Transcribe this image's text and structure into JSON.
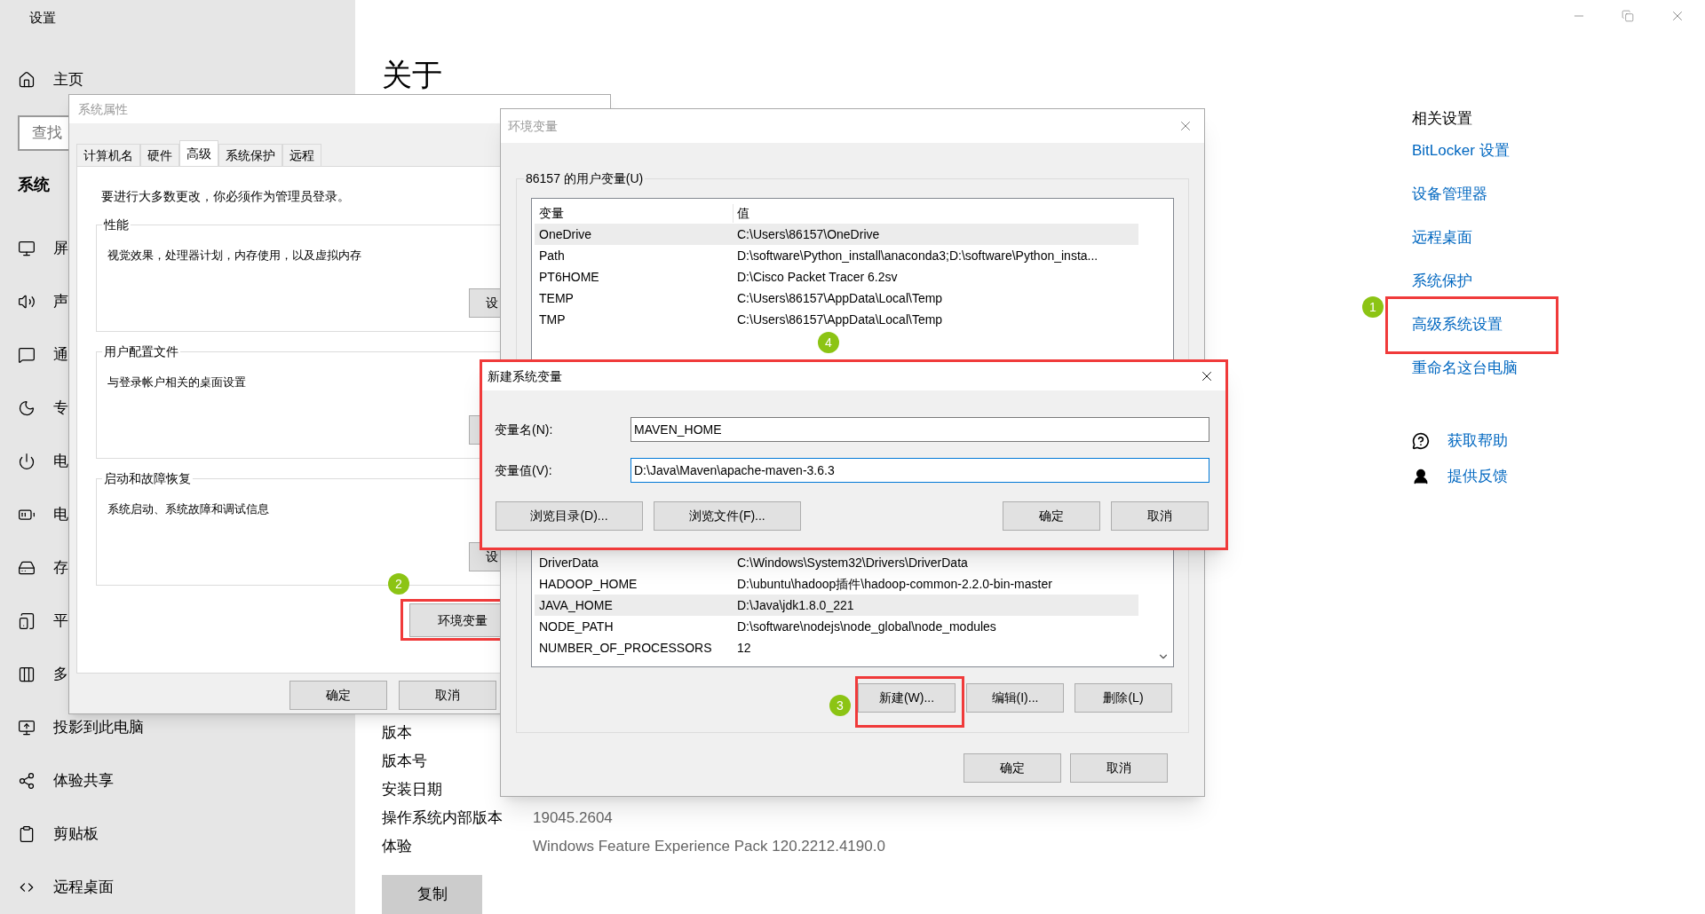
{
  "settings": {
    "title": "设置",
    "home": "主页",
    "search": {
      "placeholder": "查找"
    },
    "section": "系统",
    "items": [
      {
        "label": "屏"
      },
      {
        "label": "声"
      },
      {
        "label": "通"
      },
      {
        "label": "专"
      },
      {
        "label": "电"
      },
      {
        "label": "电"
      },
      {
        "label": "存"
      },
      {
        "label": "平"
      },
      {
        "label": "多"
      },
      {
        "label": "投影到此电脑"
      },
      {
        "label": "体验共享"
      },
      {
        "label": "剪贴板"
      },
      {
        "label": "远程桌面"
      }
    ]
  },
  "about": {
    "heading": "关于",
    "specs": [
      {
        "label": "版本"
      },
      {
        "label": "版本号"
      },
      {
        "label": "安装日期"
      },
      {
        "label": "操作系统内部版本",
        "value": "19045.2604"
      },
      {
        "label": "体验",
        "value": "Windows Feature Experience Pack 120.2212.4190.0"
      }
    ],
    "copy_button": "复制"
  },
  "related": {
    "heading": "相关设置",
    "links": [
      {
        "label": "BitLocker 设置"
      },
      {
        "label": "设备管理器"
      },
      {
        "label": "远程桌面"
      },
      {
        "label": "系统保护"
      },
      {
        "label": "高级系统设置",
        "marker": "1"
      },
      {
        "label": "重命名这台电脑"
      }
    ],
    "help_links": [
      {
        "label": "获取帮助",
        "kind": "help"
      },
      {
        "label": "提供反馈",
        "kind": "feedback"
      }
    ]
  },
  "system_properties": {
    "title": "系统属性",
    "tabs": [
      {
        "label": "计算机名",
        "selected": false
      },
      {
        "label": "硬件",
        "selected": false
      },
      {
        "label": "高级",
        "selected": true
      },
      {
        "label": "系统保护",
        "selected": false
      },
      {
        "label": "远程",
        "selected": false
      }
    ],
    "notice": "要进行大多数更改，你必须作为管理员登录。",
    "groups": [
      {
        "title": "性能",
        "description": "视觉效果，处理器计划，内存使用，以及虚拟内存",
        "button": "设"
      },
      {
        "title": "用户配置文件",
        "description": "与登录帐户相关的桌面设置"
      },
      {
        "title": "启动和故障恢复",
        "description": "系统启动、系统故障和调试信息",
        "button": "设"
      }
    ],
    "env_button": {
      "label": "环境变量",
      "marker": "2"
    },
    "buttons": [
      "确定",
      "取消"
    ]
  },
  "environment": {
    "title": "环境变量",
    "user_group": "86157 的用户变量(U)",
    "columns": [
      "变量",
      "值"
    ],
    "user_rows": [
      {
        "name": "OneDrive",
        "value": "C:\\Users\\86157\\OneDrive",
        "selected": true
      },
      {
        "name": "Path",
        "value": "D:\\software\\Python_install\\anaconda3;D:\\software\\Python_insta...",
        "selected": false
      },
      {
        "name": "PT6HOME",
        "value": "D:\\Cisco Packet Tracer 6.2sv",
        "selected": false
      },
      {
        "name": "TEMP",
        "value": "C:\\Users\\86157\\AppData\\Local\\Temp",
        "selected": false
      },
      {
        "name": "TMP",
        "value": "C:\\Users\\86157\\AppData\\Local\\Temp",
        "selected": false
      }
    ],
    "user_marker": "4",
    "system_rows": [
      {
        "name": "DriverData",
        "value": "C:\\Windows\\System32\\Drivers\\DriverData",
        "selected": false
      },
      {
        "name": "HADOOP_HOME",
        "value": "D:\\ubuntu\\hadoop插件\\hadoop-common-2.2.0-bin-master",
        "selected": false
      },
      {
        "name": "JAVA_HOME",
        "value": "D:\\Java\\jdk1.8.0_221",
        "selected": true
      },
      {
        "name": "NODE_PATH",
        "value": "D:\\software\\nodejs\\node_global\\node_modules",
        "selected": false
      },
      {
        "name": "NUMBER_OF_PROCESSORS",
        "value": "12",
        "selected": false
      }
    ],
    "system_buttons": [
      {
        "label": "新建(W)...",
        "marker": "3"
      },
      {
        "label": "编辑(I)..."
      },
      {
        "label": "删除(L)"
      }
    ],
    "buttons": [
      "确定",
      "取消"
    ]
  },
  "new_variable": {
    "title": "新建系统变量",
    "highlighted": true,
    "fields": [
      {
        "label": "变量名(N):",
        "value": "MAVEN_HOME",
        "focused": false
      },
      {
        "label": "变量值(V):",
        "value": "D:\\Java\\Maven\\apache-maven-3.6.3",
        "focused": true
      }
    ],
    "left_buttons": [
      "浏览目录(D)...",
      "浏览文件(F)..."
    ],
    "right_buttons": [
      "确定",
      "取消"
    ]
  }
}
